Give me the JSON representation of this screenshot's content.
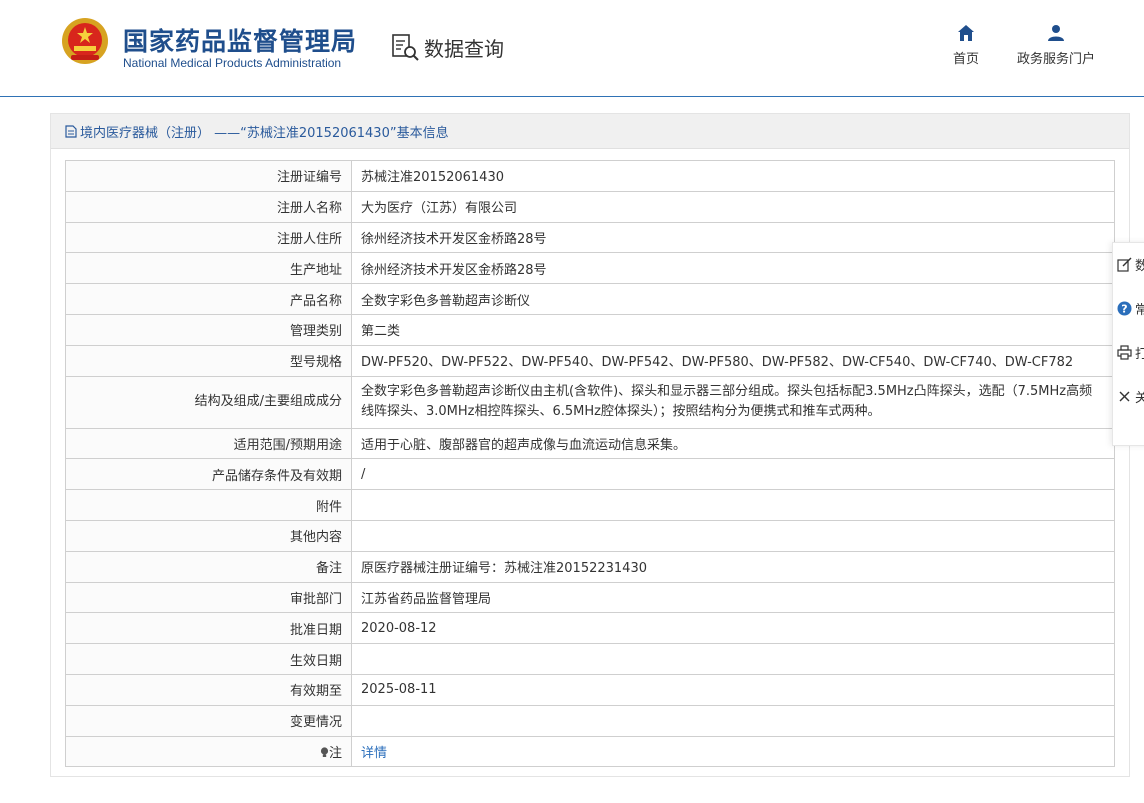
{
  "header": {
    "brand_cn": "国家药品监督管理局",
    "brand_en": "National Medical Products Administration",
    "query_label": "数据查询",
    "nav": [
      {
        "label": "首页",
        "icon": "home-icon"
      },
      {
        "label": "政务服务门户",
        "icon": "user-icon"
      }
    ]
  },
  "panel": {
    "title": "境内医疗器械（注册） ——“苏械注准20152061430”基本信息"
  },
  "rows": [
    {
      "key": "注册证编号",
      "value": "苏械注准20152061430"
    },
    {
      "key": "注册人名称",
      "value": "大为医疗（江苏）有限公司"
    },
    {
      "key": "注册人住所",
      "value": "徐州经济技术开发区金桥路28号"
    },
    {
      "key": "生产地址",
      "value": "徐州经济技术开发区金桥路28号"
    },
    {
      "key": "产品名称",
      "value": "全数字彩色多普勒超声诊断仪"
    },
    {
      "key": "管理类别",
      "value": "第二类"
    },
    {
      "key": "型号规格",
      "value": "DW-PF520、DW-PF522、DW-PF540、DW-PF542、DW-PF580、DW-PF582、DW-CF540、DW-CF740、DW-CF782"
    },
    {
      "key": "结构及组成/主要组成成分",
      "value": "全数字彩色多普勒超声诊断仪由主机(含软件)、探头和显示器三部分组成。探头包括标配3.5MHz凸阵探头，选配（7.5MHz高频线阵探头、3.0MHz相控阵探头、6.5MHz腔体探头）；按照结构分为便携式和推车式两种。"
    },
    {
      "key": "适用范围/预期用途",
      "value": "适用于心脏、腹部器官的超声成像与血流运动信息采集。"
    },
    {
      "key": "产品储存条件及有效期",
      "value": "/"
    },
    {
      "key": "附件",
      "value": ""
    },
    {
      "key": "其他内容",
      "value": ""
    },
    {
      "key": "备注",
      "value": "原医疗器械注册证编号：苏械注准20152231430"
    },
    {
      "key": "审批部门",
      "value": "江苏省药品监督管理局"
    },
    {
      "key": "批准日期",
      "value": "2020-08-12"
    },
    {
      "key": "生效日期",
      "value": ""
    },
    {
      "key": "有效期至",
      "value": "2025-08-11"
    },
    {
      "key": "变更情况",
      "value": ""
    }
  ],
  "note_row": {
    "key": "注",
    "value": "详情"
  },
  "floatbar": {
    "items": [
      {
        "label": "数",
        "icon": "edit-icon"
      },
      {
        "label": "常",
        "icon": "question-icon"
      },
      {
        "label": "打",
        "icon": "print-icon"
      },
      {
        "label": "关",
        "icon": "close-icon"
      }
    ]
  },
  "colors": {
    "brand": "#1f4e8c",
    "link": "#2a6ebb",
    "divider": "#2f72b5",
    "title_bar": "#f0f0f0"
  }
}
